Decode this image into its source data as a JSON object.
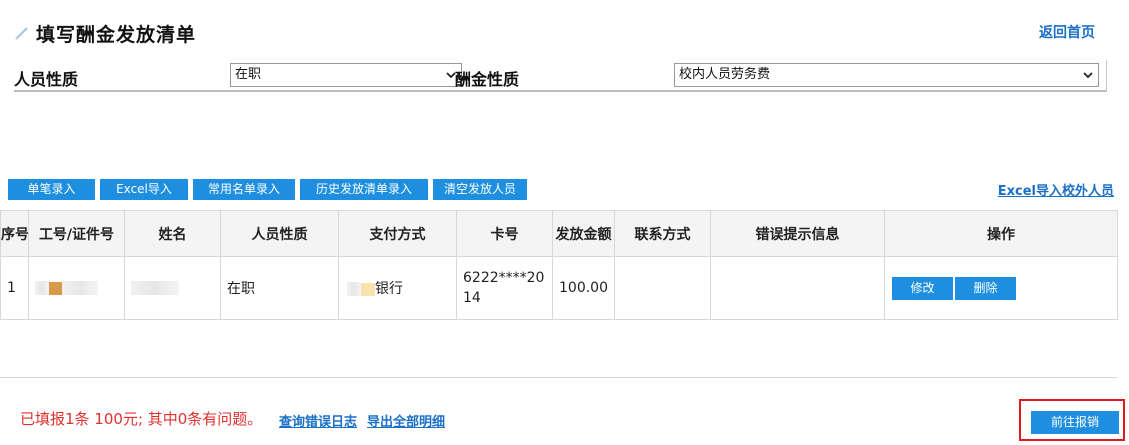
{
  "header": {
    "title": "填写酬金发放清单",
    "home_link": "返回首页",
    "icon": "pencil-icon"
  },
  "filters": {
    "person_type_label": "人员性质",
    "person_type_value": "在职",
    "pay_type_label": "酬金性质",
    "pay_type_value": "校内人员劳务费"
  },
  "actions": {
    "single_entry": "单笔录入",
    "excel_import": "Excel导入",
    "common_list": "常用名单录入",
    "history_list": "历史发放清单录入",
    "clear_people": "清空发放人员",
    "excel_external": "Excel导入校外人员"
  },
  "table": {
    "headers": [
      "序号",
      "工号/证件号",
      "姓名",
      "人员性质",
      "支付方式",
      "卡号",
      "发放金额",
      "联系方式",
      "错误提示信息",
      "操作"
    ],
    "rows": [
      {
        "index": "1",
        "person_type": "在职",
        "payment_method": "银行",
        "card_no": "6222****2014",
        "amount": "100.00",
        "contact": "",
        "error": "",
        "edit": "修改",
        "delete": "删除"
      }
    ]
  },
  "footer": {
    "summary": "已填报1条 100元; 其中0条有问题。",
    "error_log": "查询错误日志",
    "export_all": "导出全部明细",
    "submit": "前往报销"
  },
  "colors": {
    "accent": "#1e8fe0",
    "link": "#1a6fc7",
    "error_text": "#e0312e",
    "highlight_border": "#e0191c"
  }
}
